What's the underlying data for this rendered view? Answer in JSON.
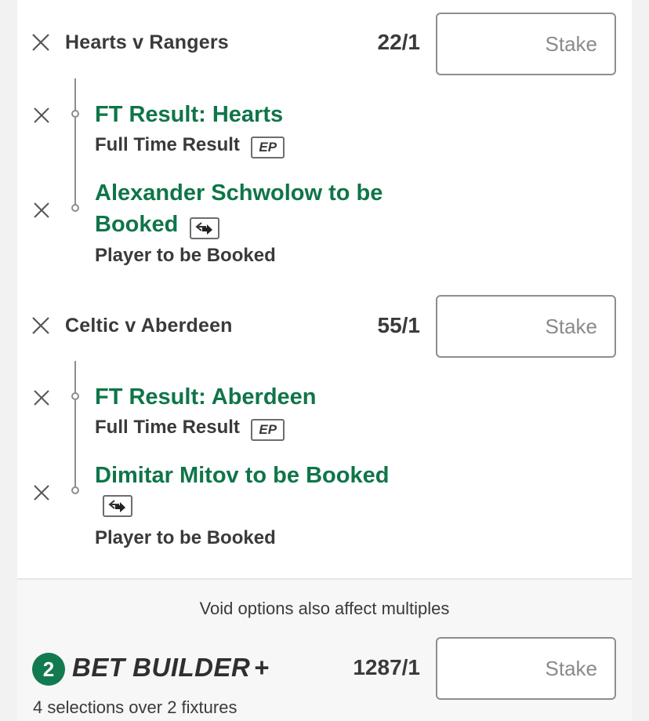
{
  "icons": {
    "remove": "close-icon",
    "early_payout": "ep-badge",
    "swap": "swap-icon"
  },
  "colors": {
    "selection_green": "#0f7548",
    "badge_green": "#127a4f"
  },
  "fixtures": [
    {
      "title": "Hearts v Rangers",
      "odds": "22/1",
      "stake_placeholder": "Stake",
      "selections": [
        {
          "title": "FT Result: Hearts",
          "market": "Full Time Result",
          "badge": "EP"
        },
        {
          "title_line1": "Alexander Schwolow to be",
          "title_line2": "Booked",
          "market": "Player to be Booked"
        }
      ]
    },
    {
      "title": "Celtic v Aberdeen",
      "odds": "55/1",
      "stake_placeholder": "Stake",
      "selections": [
        {
          "title": "FT Result: Aberdeen",
          "market": "Full Time Result",
          "badge": "EP"
        },
        {
          "title": "Dimitar Mitov to be Booked",
          "market": "Player to be Booked"
        }
      ]
    }
  ],
  "footer": {
    "void_note": "Void options also affect multiples",
    "bet_builder": {
      "count": "2",
      "title": "BET BUILDER",
      "plus": "+",
      "odds": "1287/1",
      "stake_placeholder": "Stake",
      "subtitle": "4 selections over 2 fixtures"
    }
  }
}
